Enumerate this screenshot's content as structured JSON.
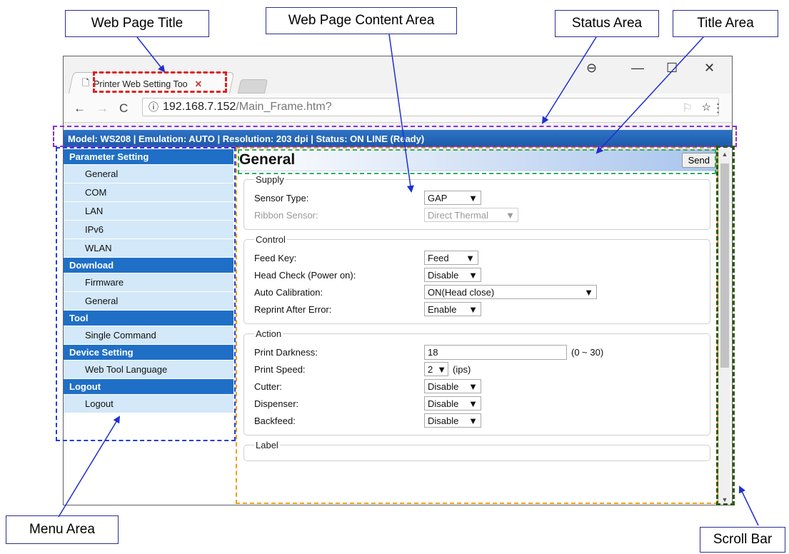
{
  "callouts": {
    "web_page_title": "Web Page Title",
    "content_area": "Web Page Content Area",
    "status_area": "Status Area",
    "title_area": "Title Area",
    "menu_area": "Menu Area",
    "scroll_bar": "Scroll Bar"
  },
  "browser": {
    "tab_title": "Printer Web Setting Too",
    "tab_close": "✕",
    "url_host": "192.168.7.152",
    "url_path": "/Main_Frame.htm?"
  },
  "status_text": "Model: WS208 | Emulation: AUTO | Resolution: 203 dpi | Status: ON LINE (Ready)",
  "menu": {
    "groups": [
      {
        "header": "Parameter Setting",
        "items": [
          "General",
          "COM",
          "LAN",
          "IPv6",
          "WLAN"
        ]
      },
      {
        "header": "Download",
        "items": [
          "Firmware",
          "General"
        ]
      },
      {
        "header": "Tool",
        "items": [
          "Single Command"
        ]
      },
      {
        "header": "Device Setting",
        "items": [
          "Web Tool Language"
        ]
      },
      {
        "header": "Logout",
        "items": [
          "Logout"
        ]
      }
    ]
  },
  "content": {
    "title": "General",
    "send_label": "Send",
    "supply": {
      "legend": "Supply",
      "sensor_type_label": "Sensor Type:",
      "sensor_type_value": "GAP",
      "ribbon_sensor_label": "Ribbon Sensor:",
      "ribbon_sensor_value": "Direct Thermal"
    },
    "control": {
      "legend": "Control",
      "feed_key_label": "Feed Key:",
      "feed_key_value": "Feed",
      "head_check_label": "Head Check (Power on):",
      "head_check_value": "Disable",
      "auto_cal_label": "Auto Calibration:",
      "auto_cal_value": "ON(Head close)",
      "reprint_label": "Reprint After Error:",
      "reprint_value": "Enable"
    },
    "action": {
      "legend": "Action",
      "darkness_label": "Print Darkness:",
      "darkness_value": "18",
      "darkness_range": "(0 ~ 30)",
      "speed_label": "Print Speed:",
      "speed_value": "2",
      "speed_unit": "(ips)",
      "cutter_label": "Cutter:",
      "cutter_value": "Disable",
      "dispenser_label": "Dispenser:",
      "dispenser_value": "Disable",
      "backfeed_label": "Backfeed:",
      "backfeed_value": "Disable"
    },
    "label": {
      "legend": "Label"
    }
  },
  "colors": {
    "status_bar": "#1b5aa8",
    "menu_header": "#1f6fc6",
    "menu_item": "#d3e8f8",
    "callout_border": "#2b2f8f"
  }
}
